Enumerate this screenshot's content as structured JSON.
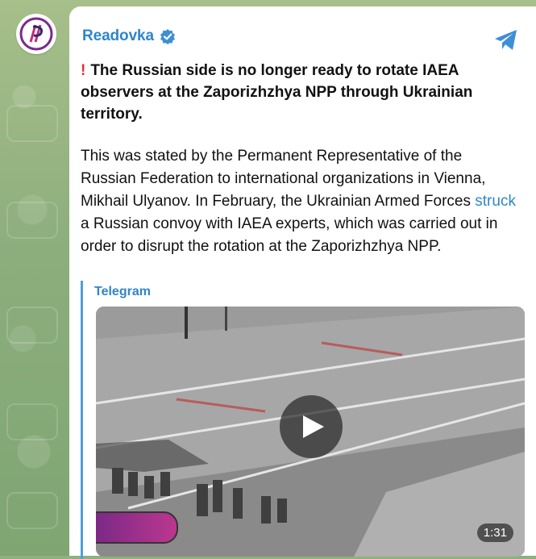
{
  "post": {
    "channel_name": "Readovka",
    "headline": "The Russian side is no longer ready to rotate IAEA observers at the Zaporizhzhya NPP through Ukrainian territory.",
    "body_before_link": "This was stated by the Permanent Representative of the Russian Federation to international organizations in Vienna, Mikhail Ulyanov. In February, the Ukrainian Armed Forces ",
    "link_text": "struck",
    "body_after_link": " a Russian convoy with IAEA experts, which was carried out in order to disrupt the rotation at the Zaporizhzhya NPP."
  },
  "quote": {
    "source": "Telegram"
  },
  "video": {
    "duration": "1:31"
  },
  "icons": {
    "verified": "verified-badge-icon",
    "share": "telegram-share-icon",
    "alert": "red-exclamation-icon",
    "play": "play-icon"
  },
  "colors": {
    "link": "#2f86c8",
    "alert": "#e23131",
    "quote_bar": "#4e9fd8"
  }
}
